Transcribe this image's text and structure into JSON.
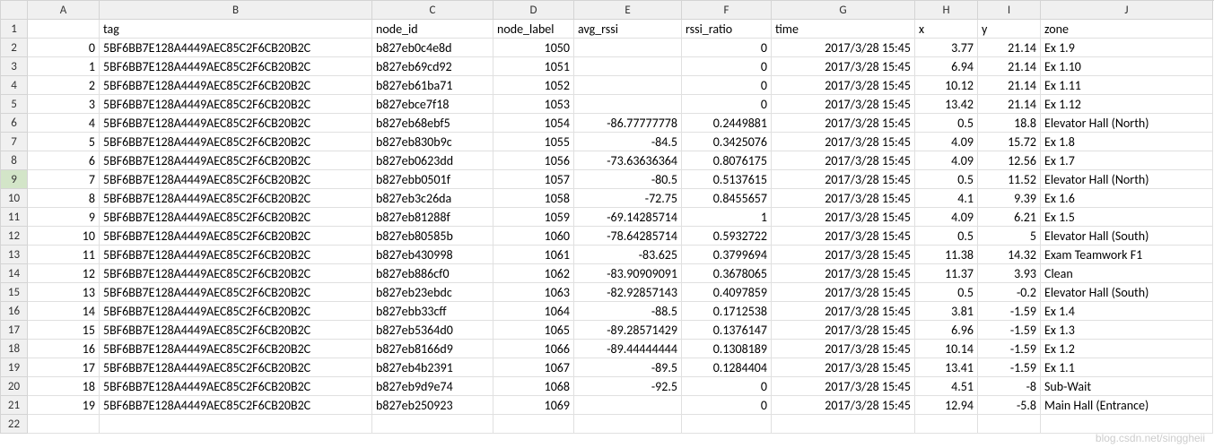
{
  "columns": [
    "A",
    "B",
    "C",
    "D",
    "E",
    "F",
    "G",
    "H",
    "I",
    "J"
  ],
  "selected_row_header": 9,
  "headers_row": {
    "A": "",
    "B": "tag",
    "C": "node_id",
    "D": "node_label",
    "E": "avg_rssi",
    "F": "rssi_ratio",
    "G": "time",
    "H": "x",
    "I": "y",
    "J": "zone"
  },
  "rows": [
    {
      "A": "0",
      "B": "5BF6BB7E128A4449AEC85C2F6CB20B2C",
      "C": "b827eb0c4e8d",
      "D": "1050",
      "E": "",
      "F": "0",
      "G": "2017/3/28 15:45",
      "H": "3.77",
      "I": "21.14",
      "J": "Ex 1.9"
    },
    {
      "A": "1",
      "B": "5BF6BB7E128A4449AEC85C2F6CB20B2C",
      "C": "b827eb69cd92",
      "D": "1051",
      "E": "",
      "F": "0",
      "G": "2017/3/28 15:45",
      "H": "6.94",
      "I": "21.14",
      "J": "Ex 1.10"
    },
    {
      "A": "2",
      "B": "5BF6BB7E128A4449AEC85C2F6CB20B2C",
      "C": "b827eb61ba71",
      "D": "1052",
      "E": "",
      "F": "0",
      "G": "2017/3/28 15:45",
      "H": "10.12",
      "I": "21.14",
      "J": "Ex 1.11"
    },
    {
      "A": "3",
      "B": "5BF6BB7E128A4449AEC85C2F6CB20B2C",
      "C": "b827ebce7f18",
      "D": "1053",
      "E": "",
      "F": "0",
      "G": "2017/3/28 15:45",
      "H": "13.42",
      "I": "21.14",
      "J": "Ex 1.12"
    },
    {
      "A": "4",
      "B": "5BF6BB7E128A4449AEC85C2F6CB20B2C",
      "C": "b827eb68ebf5",
      "D": "1054",
      "E": "-86.77777778",
      "F": "0.2449881",
      "G": "2017/3/28 15:45",
      "H": "0.5",
      "I": "18.8",
      "J": "Elevator Hall (North)"
    },
    {
      "A": "5",
      "B": "5BF6BB7E128A4449AEC85C2F6CB20B2C",
      "C": "b827eb830b9c",
      "D": "1055",
      "E": "-84.5",
      "F": "0.3425076",
      "G": "2017/3/28 15:45",
      "H": "4.09",
      "I": "15.72",
      "J": "Ex 1.8"
    },
    {
      "A": "6",
      "B": "5BF6BB7E128A4449AEC85C2F6CB20B2C",
      "C": "b827eb0623dd",
      "D": "1056",
      "E": "-73.63636364",
      "F": "0.8076175",
      "G": "2017/3/28 15:45",
      "H": "4.09",
      "I": "12.56",
      "J": "Ex 1.7"
    },
    {
      "A": "7",
      "B": "5BF6BB7E128A4449AEC85C2F6CB20B2C",
      "C": "b827ebb0501f",
      "D": "1057",
      "E": "-80.5",
      "F": "0.5137615",
      "G": "2017/3/28 15:45",
      "H": "0.5",
      "I": "11.52",
      "J": "Elevator Hall (North)"
    },
    {
      "A": "8",
      "B": "5BF6BB7E128A4449AEC85C2F6CB20B2C",
      "C": "b827eb3c26da",
      "D": "1058",
      "E": "-72.75",
      "F": "0.8455657",
      "G": "2017/3/28 15:45",
      "H": "4.1",
      "I": "9.39",
      "J": "Ex 1.6"
    },
    {
      "A": "9",
      "B": "5BF6BB7E128A4449AEC85C2F6CB20B2C",
      "C": "b827eb81288f",
      "D": "1059",
      "E": "-69.14285714",
      "F": "1",
      "G": "2017/3/28 15:45",
      "H": "4.09",
      "I": "6.21",
      "J": "Ex 1.5"
    },
    {
      "A": "10",
      "B": "5BF6BB7E128A4449AEC85C2F6CB20B2C",
      "C": "b827eb80585b",
      "D": "1060",
      "E": "-78.64285714",
      "F": "0.5932722",
      "G": "2017/3/28 15:45",
      "H": "0.5",
      "I": "5",
      "J": "Elevator Hall (South)"
    },
    {
      "A": "11",
      "B": "5BF6BB7E128A4449AEC85C2F6CB20B2C",
      "C": "b827eb430998",
      "D": "1061",
      "E": "-83.625",
      "F": "0.3799694",
      "G": "2017/3/28 15:45",
      "H": "11.38",
      "I": "14.32",
      "J": "Exam Teamwork F1"
    },
    {
      "A": "12",
      "B": "5BF6BB7E128A4449AEC85C2F6CB20B2C",
      "C": "b827eb886cf0",
      "D": "1062",
      "E": "-83.90909091",
      "F": "0.3678065",
      "G": "2017/3/28 15:45",
      "H": "11.37",
      "I": "3.93",
      "J": "Clean"
    },
    {
      "A": "13",
      "B": "5BF6BB7E128A4449AEC85C2F6CB20B2C",
      "C": "b827eb23ebdc",
      "D": "1063",
      "E": "-82.92857143",
      "F": "0.4097859",
      "G": "2017/3/28 15:45",
      "H": "0.5",
      "I": "-0.2",
      "J": "Elevator Hall (South)"
    },
    {
      "A": "14",
      "B": "5BF6BB7E128A4449AEC85C2F6CB20B2C",
      "C": "b827ebb33cff",
      "D": "1064",
      "E": "-88.5",
      "F": "0.1712538",
      "G": "2017/3/28 15:45",
      "H": "3.81",
      "I": "-1.59",
      "J": "Ex 1.4"
    },
    {
      "A": "15",
      "B": "5BF6BB7E128A4449AEC85C2F6CB20B2C",
      "C": "b827eb5364d0",
      "D": "1065",
      "E": "-89.28571429",
      "F": "0.1376147",
      "G": "2017/3/28 15:45",
      "H": "6.96",
      "I": "-1.59",
      "J": "Ex 1.3"
    },
    {
      "A": "16",
      "B": "5BF6BB7E128A4449AEC85C2F6CB20B2C",
      "C": "b827eb8166d9",
      "D": "1066",
      "E": "-89.44444444",
      "F": "0.1308189",
      "G": "2017/3/28 15:45",
      "H": "10.14",
      "I": "-1.59",
      "J": "Ex 1.2"
    },
    {
      "A": "17",
      "B": "5BF6BB7E128A4449AEC85C2F6CB20B2C",
      "C": "b827eb4b2391",
      "D": "1067",
      "E": "-89.5",
      "F": "0.1284404",
      "G": "2017/3/28 15:45",
      "H": "13.41",
      "I": "-1.59",
      "J": "Ex 1.1"
    },
    {
      "A": "18",
      "B": "5BF6BB7E128A4449AEC85C2F6CB20B2C",
      "C": "b827eb9d9e74",
      "D": "1068",
      "E": "-92.5",
      "F": "0",
      "G": "2017/3/28 15:45",
      "H": "4.51",
      "I": "-8",
      "J": "Sub-Wait"
    },
    {
      "A": "19",
      "B": "5BF6BB7E128A4449AEC85C2F6CB20B2C",
      "C": "b827eb250923",
      "D": "1069",
      "E": "",
      "F": "0",
      "G": "2017/3/28 15:45",
      "H": "12.94",
      "I": "-5.8",
      "J": "Main Hall (Entrance)"
    }
  ],
  "empty_rows": [
    22
  ],
  "watermark": "blog.csdn.net/singgheii"
}
